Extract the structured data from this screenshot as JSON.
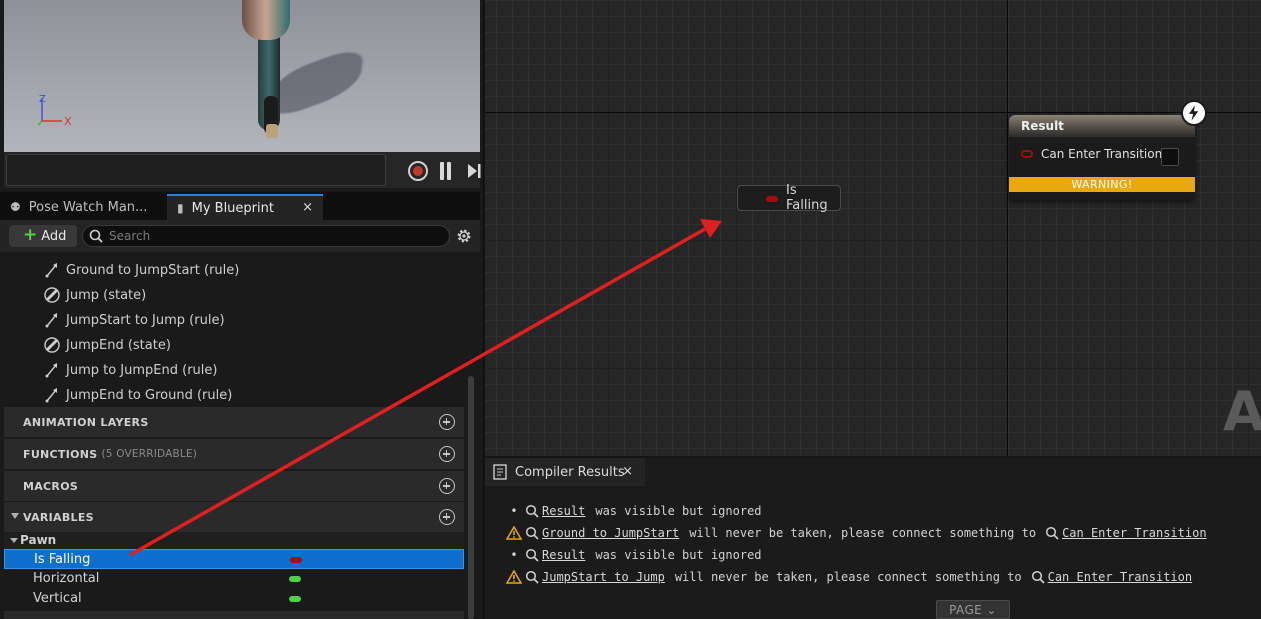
{
  "viewport": {
    "axis_z": "Z",
    "axis_x": "X"
  },
  "tabs": [
    {
      "label": "Pose Watch Man..."
    },
    {
      "label": "My Blueprint",
      "close": "×"
    }
  ],
  "toolbar": {
    "add_label": "Add",
    "search_placeholder": "Search"
  },
  "tree_items": [
    {
      "label": "Ground to JumpStart (rule)",
      "icon": "rule-icon"
    },
    {
      "label": "Jump (state)",
      "icon": "state-icon"
    },
    {
      "label": "JumpStart to Jump (rule)",
      "icon": "rule-icon"
    },
    {
      "label": "JumpEnd (state)",
      "icon": "state-icon"
    },
    {
      "label": "Jump to JumpEnd (rule)",
      "icon": "rule-icon"
    },
    {
      "label": "JumpEnd to Ground (rule)",
      "icon": "rule-icon"
    }
  ],
  "sections": {
    "animation_layers": "ANIMATION LAYERS",
    "functions": "FUNCTIONS",
    "functions_sub": "(5 OVERRIDABLE)",
    "macros": "MACROS",
    "variables": "VARIABLES"
  },
  "variables": {
    "category": "Pawn",
    "items": [
      {
        "label": "Is Falling",
        "color": "#a00e0e",
        "selected": true
      },
      {
        "label": "Horizontal",
        "color": "#4fd247",
        "selected": false
      },
      {
        "label": "Vertical",
        "color": "#4fd247",
        "selected": false
      }
    ]
  },
  "graph": {
    "get_node_label": "Is Falling",
    "result_node": {
      "title": "Result",
      "pin_label": "Can Enter Transition",
      "warning": "WARNING!"
    },
    "watermark": "A"
  },
  "compiler": {
    "tab_label": "Compiler Results",
    "tab_close": "×",
    "messages": [
      {
        "type": "info",
        "bullet": "•",
        "link": "Result",
        "text": "was visible but ignored",
        "link2": ""
      },
      {
        "type": "warning",
        "bullet": "",
        "link": "Ground to JumpStart",
        "text": "will never be taken, please connect something to",
        "link2": "Can Enter Transition"
      },
      {
        "type": "info",
        "bullet": "•",
        "link": "Result",
        "text": "was visible but ignored",
        "link2": ""
      },
      {
        "type": "warning",
        "bullet": "",
        "link": "JumpStart to Jump",
        "text": "will never be taken, please connect something to",
        "link2": "Can Enter Transition"
      }
    ],
    "page_label": "PAGE"
  },
  "colors": {
    "accent": "#0f6fce",
    "bool_pin": "#a00e0e",
    "float_pin": "#4fd247",
    "warning": "#e8a80f",
    "annotation_arrow": "#e02020"
  }
}
